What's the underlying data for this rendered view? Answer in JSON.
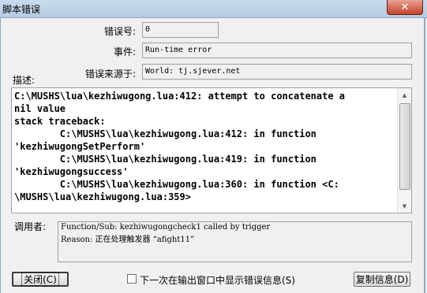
{
  "window": {
    "title": "脚本错误",
    "close_glyph": "✕"
  },
  "fields": {
    "error_no_label": "错误号:",
    "error_no_value": "0",
    "event_label": "事件:",
    "event_value": "Run-time error",
    "source_label": "错误来源于:",
    "source_value": "World: tj.sjever.net",
    "description_label": "描述:",
    "description_lines": [
      "C:\\MUSHS\\lua\\kezhiwugong.lua:412: attempt to concatenate a",
      "nil value",
      "stack traceback:",
      "        C:\\MUSHS\\lua\\kezhiwugong.lua:412: in function",
      "'kezhiwugongSetPerform'",
      "        C:\\MUSHS\\lua\\kezhiwugong.lua:419: in function",
      "'kezhiwugongsuccess'",
      "        C:\\MUSHS\\lua\\kezhiwugong.lua:360: in function <C:",
      "\\MUSHS\\lua\\kezhiwugong.lua:359>"
    ],
    "caller_label": "调用者:",
    "caller_line1": "Function/Sub: kezhiwugongcheck1 called by trigger",
    "caller_line2": "Reason: 正在处理触发器 “afight11”"
  },
  "buttons": {
    "close": "关闭(C)",
    "copy": "复制信息(D)"
  },
  "checkbox": {
    "label": "下一次在输出窗口中显示错误信息(S)",
    "checked": false
  },
  "icons": {
    "close": "close-icon",
    "scroll_up": "scroll-up-icon",
    "scroll_down": "scroll-down-icon"
  }
}
